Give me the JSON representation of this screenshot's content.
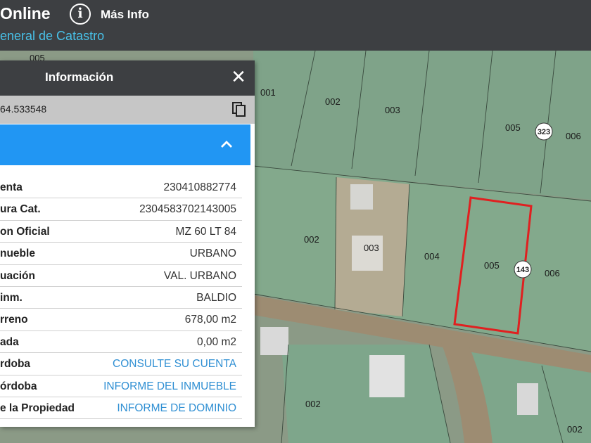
{
  "header": {
    "title": "Online",
    "subtitle": "eneral de Catastro",
    "info_icon": "i",
    "more_info": "Más Info"
  },
  "map": {
    "lot_labels": [
      "005",
      "001",
      "002",
      "003",
      "005",
      "006",
      "002",
      "003",
      "004",
      "005",
      "006",
      "002",
      "002"
    ],
    "badges": [
      "323",
      "143"
    ],
    "highlight_color": "#e02020"
  },
  "panel": {
    "title": "Información",
    "close_label": "✕",
    "coordinates": "64.533548",
    "rows": [
      {
        "key": "enta",
        "value": "230410882774",
        "link": false
      },
      {
        "key": "ura Cat.",
        "value": "2304583702143005",
        "link": false
      },
      {
        "key": "on Oficial",
        "value": "MZ 60 LT 84",
        "link": false
      },
      {
        "key": "nueble",
        "value": "URBANO",
        "link": false
      },
      {
        "key": "uación",
        "value": "VAL. URBANO",
        "link": false
      },
      {
        "key": "inm.",
        "value": "BALDIO",
        "link": false
      },
      {
        "key": "rreno",
        "value": "678,00 m2",
        "link": false
      },
      {
        "key": "ada",
        "value": "0,00 m2",
        "link": false
      },
      {
        "key": "rdoba",
        "value": "CONSULTE SU CUENTA",
        "link": true
      },
      {
        "key": "órdoba",
        "value": "INFORME DEL INMUEBLE",
        "link": true
      },
      {
        "key": "e la Propiedad",
        "value": "INFORME DE DOMINIO",
        "link": true
      }
    ]
  },
  "colors": {
    "header_bg": "#3d3f42",
    "accent_blue": "#2196f3",
    "subtitle_blue": "#48c1e8",
    "link_blue": "#2f8fd3"
  }
}
